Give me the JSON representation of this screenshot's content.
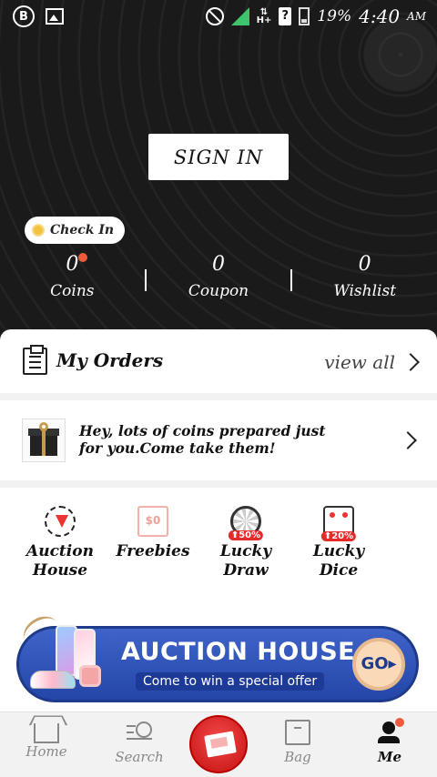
{
  "status_bar": {
    "left_icons": [
      "b-notification-icon",
      "image-notification-icon"
    ],
    "network_label": "H+",
    "battery_percent": "19%",
    "time": "4:40",
    "ampm": "AM"
  },
  "header": {
    "sign_in_label": "SIGN IN",
    "check_in_label": "Check In",
    "stats": [
      {
        "value": "0",
        "label": "Coins",
        "has_dot": true
      },
      {
        "value": "0",
        "label": "Coupon"
      },
      {
        "value": "0",
        "label": "Wishlist"
      }
    ]
  },
  "orders": {
    "title": "My Orders",
    "view_all_label": "view all"
  },
  "coins_promo": {
    "text": "Hey, lots of coins prepared just for you.Come take them!"
  },
  "features": [
    {
      "label": "Auction House",
      "icon": "auction-house-icon"
    },
    {
      "label": "Freebies",
      "icon": "freebies-icon",
      "icon_text": "$0"
    },
    {
      "label": "Lucky Draw",
      "icon": "lucky-draw-wheel-icon",
      "tag": "50%"
    },
    {
      "label": "Lucky Dice",
      "icon": "lucky-dice-icon",
      "tag": "20%"
    }
  ],
  "banner": {
    "title": "AUCTION HOUSE",
    "subtitle": "Come to win a special offer",
    "go_label": "GO"
  },
  "bottom_nav": {
    "items": [
      {
        "label": "Home",
        "icon": "home-icon"
      },
      {
        "label": "Search",
        "icon": "search-icon"
      },
      {
        "label": "",
        "icon": "red-envelope-icon"
      },
      {
        "label": "Bag",
        "icon": "bag-icon"
      },
      {
        "label": "Me",
        "icon": "me-icon",
        "active": true
      }
    ]
  },
  "colors": {
    "header_bg": "#1a1a1a",
    "accent_red": "#e52a2a",
    "banner_blue": "#2f56bd",
    "dot_orange": "#f05a3c"
  }
}
